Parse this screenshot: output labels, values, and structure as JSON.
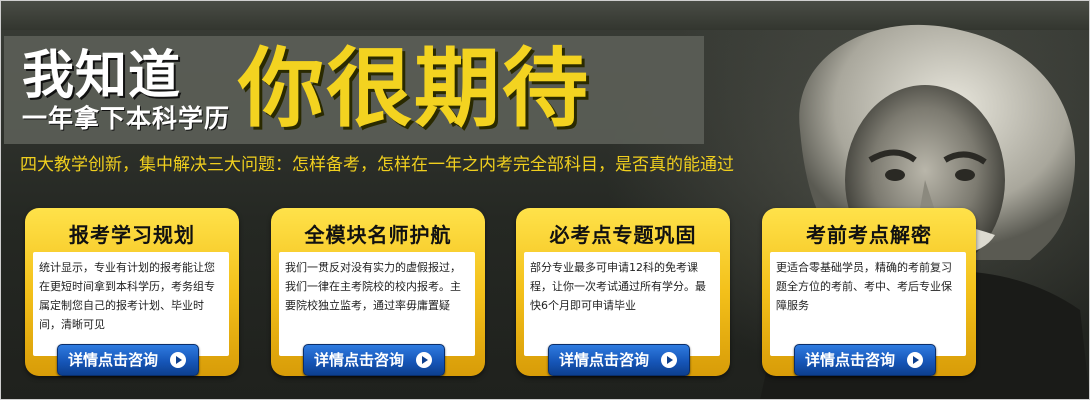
{
  "banner": {
    "title_small": "我知道",
    "title_sub": "一年拿下本科学历",
    "title_big": "你很期待",
    "headline": "四大教学创新，集中解决三大问题：怎样备考，怎样在一年之内考完全部科目，是否真的能通过"
  },
  "cards": [
    {
      "title": "报考学习规划",
      "text": "统计显示，专业有计划的报考能让您在更短时间拿到本科学历，考务组专属定制您自己的报考计划、毕业时间，清晰可见",
      "button": "详情点击咨询"
    },
    {
      "title": "全模块名师护航",
      "text": "我们一贯反对没有实力的虚假报过，我们一律在主考院校的校内报考。主要院校独立监考，通过率毋庸置疑",
      "button": "详情点击咨询"
    },
    {
      "title": "必考点专题巩固",
      "text": "部分专业最多可申请12科的免考课程，让你一次考试通过所有学分。最快6个月即可申请毕业",
      "button": "详情点击咨询"
    },
    {
      "title": "考前考点解密",
      "text": "更适合零基础学员，精确的考前复习题全方位的考前、考中、考后专业保障服务",
      "button": "详情点击咨询"
    }
  ],
  "colors": {
    "accent_yellow": "#f3d320",
    "card_yellow": "#f3c01a",
    "button_blue": "#1656b8",
    "background": "#2a2c27"
  },
  "icons": [
    "play-circle-icon",
    "portrait-image"
  ]
}
